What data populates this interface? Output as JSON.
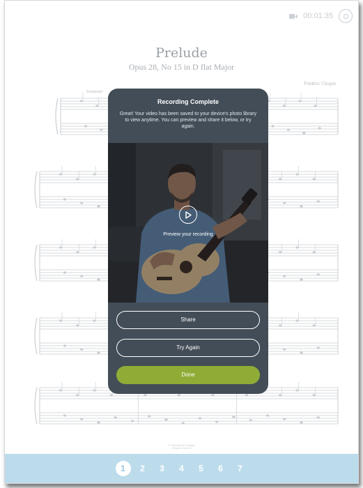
{
  "status": {
    "timer": "00:01:35",
    "camera_icon": "video-camera-icon",
    "stop_icon": "record-stop-icon"
  },
  "score": {
    "title": "Prelude",
    "subtitle": "Opus 28, No 15 in D flat Major",
    "composer": "Frédéric Chopin",
    "tempo": "Sostenuto",
    "copyright_line1": "© 2018 Musical Example",
    "copyright_line2": "All rights reserved"
  },
  "modal": {
    "title": "Recording Complete",
    "message": "Great! Your video has been saved to your device's photo library to view anytime. You can preview and share it below, or try again.",
    "preview_label": "Preview your recording",
    "share_label": "Share",
    "try_again_label": "Try Again",
    "done_label": "Done"
  },
  "pages": [
    "1",
    "2",
    "3",
    "4",
    "5",
    "6",
    "7"
  ],
  "current_page": "1",
  "colors": {
    "modal_bg": "#434d57",
    "done_button": "#8fad36",
    "page_bar": "#bcdcec"
  }
}
